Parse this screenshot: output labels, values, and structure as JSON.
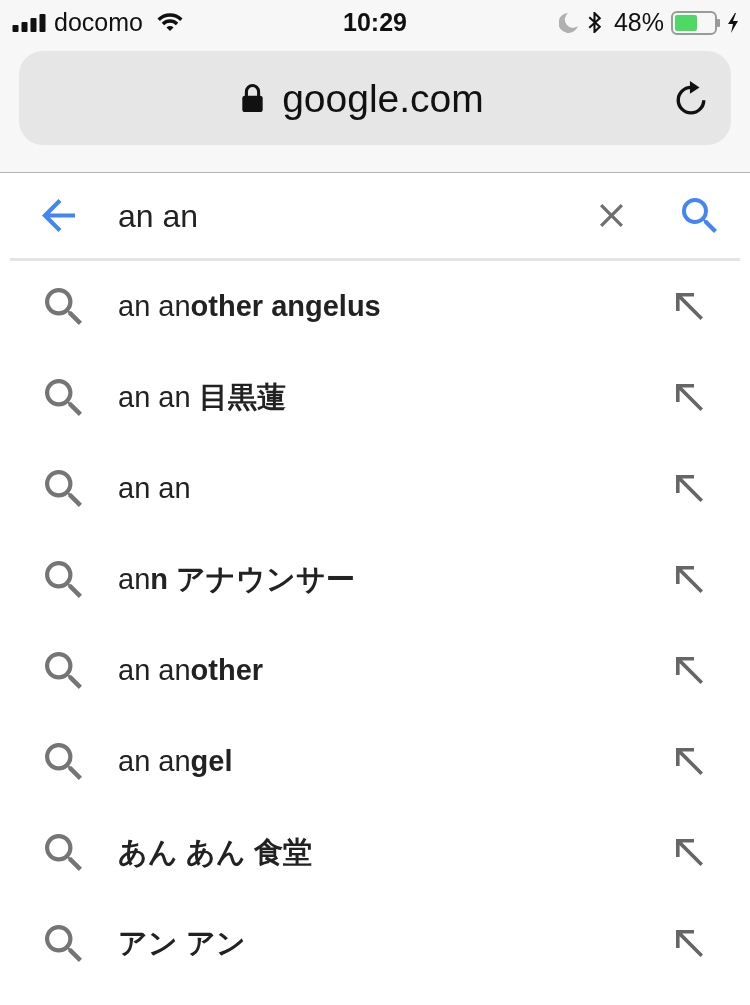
{
  "status_bar": {
    "carrier": "docomo",
    "time": "10:29",
    "battery": "48%"
  },
  "address_bar": {
    "url": "google.com"
  },
  "search": {
    "value": "an an"
  },
  "suggestions": [
    {
      "text": "an an**other angelus**",
      "bold": false
    },
    {
      "text": "an an **目黒蓮**",
      "bold": false
    },
    {
      "text": "an an",
      "bold": false
    },
    {
      "text": "an**n アナウンサー**",
      "bold": false
    },
    {
      "text": "an an**other**",
      "bold": false
    },
    {
      "text": "an an**gel**",
      "bold": false
    },
    {
      "text": "あん あん 食堂",
      "bold": true
    },
    {
      "text": "アン アン",
      "bold": true
    }
  ]
}
